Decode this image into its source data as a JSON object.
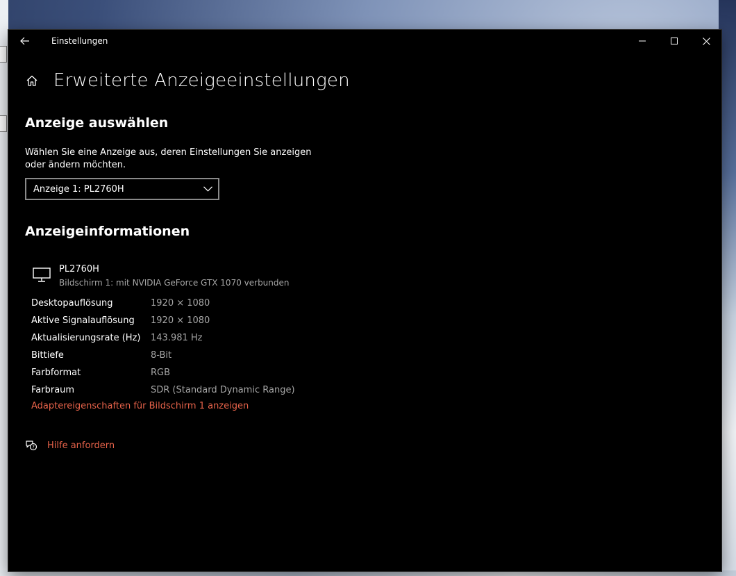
{
  "window": {
    "title": "Einstellungen"
  },
  "page": {
    "title": "Erweiterte Anzeigeeinstellungen"
  },
  "select_display": {
    "heading": "Anzeige auswählen",
    "description": "Wählen Sie eine Anzeige aus, deren Einstellungen Sie anzeigen oder ändern möchten.",
    "selected": "Anzeige 1: PL2760H"
  },
  "display_info": {
    "heading": "Anzeigeinformationen",
    "monitor_name": "PL2760H",
    "monitor_subtitle": "Bildschirm 1: mit NVIDIA GeForce GTX 1070 verbunden",
    "rows": [
      {
        "label": "Desktopauflösung",
        "value": "1920 × 1080"
      },
      {
        "label": "Aktive Signalauflösung",
        "value": "1920 × 1080"
      },
      {
        "label": "Aktualisierungsrate (Hz)",
        "value": "143.981 Hz"
      },
      {
        "label": "Bittiefe",
        "value": "8-Bit"
      },
      {
        "label": "Farbformat",
        "value": "RGB"
      },
      {
        "label": "Farbraum",
        "value": "SDR (Standard Dynamic Range)"
      }
    ],
    "adapter_link": "Adaptereigenschaften für Bildschirm 1 anzeigen"
  },
  "help": {
    "label": "Hilfe anfordern"
  },
  "colors": {
    "background": "#000000",
    "text": "#ffffff",
    "secondary_text": "#a6a6a6",
    "accent_link": "#e8634a"
  },
  "icons": [
    "back-arrow-icon",
    "minimize-icon",
    "maximize-icon",
    "close-icon",
    "home-icon",
    "chevron-down-icon",
    "monitor-icon",
    "help-chat-icon"
  ]
}
